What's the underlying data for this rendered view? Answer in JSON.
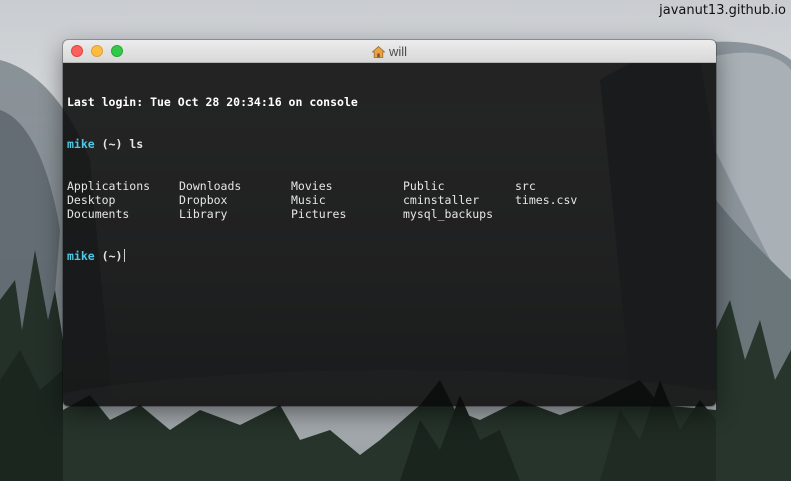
{
  "watermark": "javanut13.github.io",
  "window": {
    "title": "will",
    "title_icon": "home-icon"
  },
  "terminal": {
    "last_login": "Last login: Tue Oct 28 20:34:16 on console",
    "prompt_user": "mike",
    "prompt_dir": "(~)",
    "command": "ls",
    "listing": [
      "Applications",
      "Downloads",
      "Movies",
      "Public",
      "src",
      "Desktop",
      "Dropbox",
      "Music",
      "cminstaller",
      "times.csv",
      "Documents",
      "Library",
      "Pictures",
      "mysql_backups",
      ""
    ]
  },
  "colors": {
    "prompt_user": "#4ec9e5",
    "close": "#fc605c",
    "minimize": "#fdbc40",
    "maximize": "#34c84a"
  }
}
